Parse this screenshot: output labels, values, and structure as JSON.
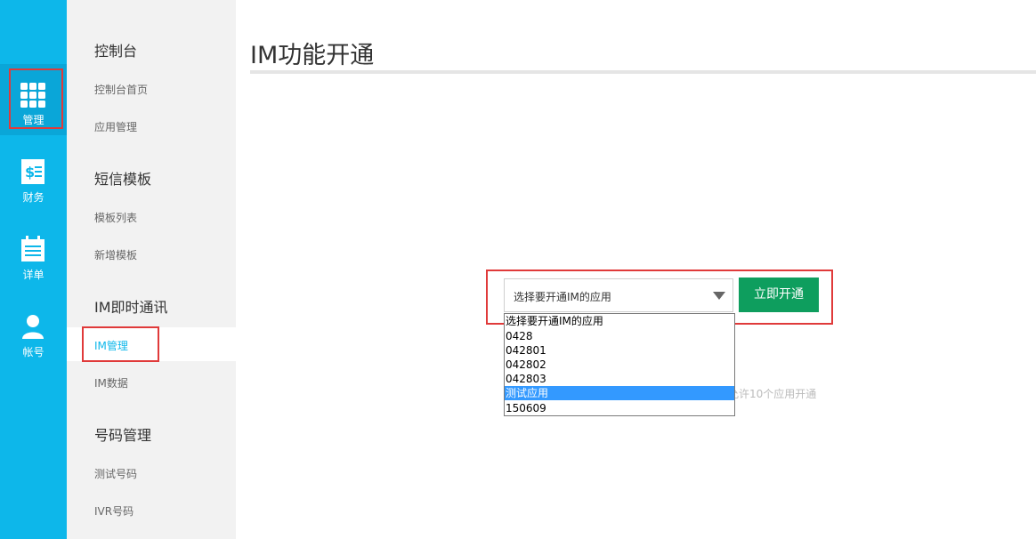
{
  "rail": {
    "items": [
      {
        "label": "管理",
        "icon": "grid-icon"
      },
      {
        "label": "财务",
        "icon": "money-icon"
      },
      {
        "label": "详单",
        "icon": "calendar-icon"
      },
      {
        "label": "帐号",
        "icon": "user-icon"
      }
    ]
  },
  "sidebar": {
    "sections": [
      {
        "title": "控制台",
        "links": [
          "控制台首页",
          "应用管理"
        ]
      },
      {
        "title": "短信模板",
        "links": [
          "模板列表",
          "新增模板"
        ]
      },
      {
        "title": "IM即时通讯",
        "links": [
          "IM管理",
          "IM数据"
        ]
      },
      {
        "title": "号码管理",
        "links": [
          "测试号码",
          "IVR号码"
        ]
      }
    ]
  },
  "main": {
    "title": "IM功能开通",
    "select_value": "选择要开通IM的应用",
    "button": "立即开通",
    "hint": "允许10个应用开通",
    "options": [
      "选择要开通IM的应用",
      "0428",
      "042801",
      "042802",
      "042803",
      "测试应用",
      "150609"
    ]
  },
  "colors": {
    "rail": "#0db7ea",
    "button": "#0e9e5e",
    "highlight": "#3399ff",
    "annotation": "#e03a3a"
  }
}
